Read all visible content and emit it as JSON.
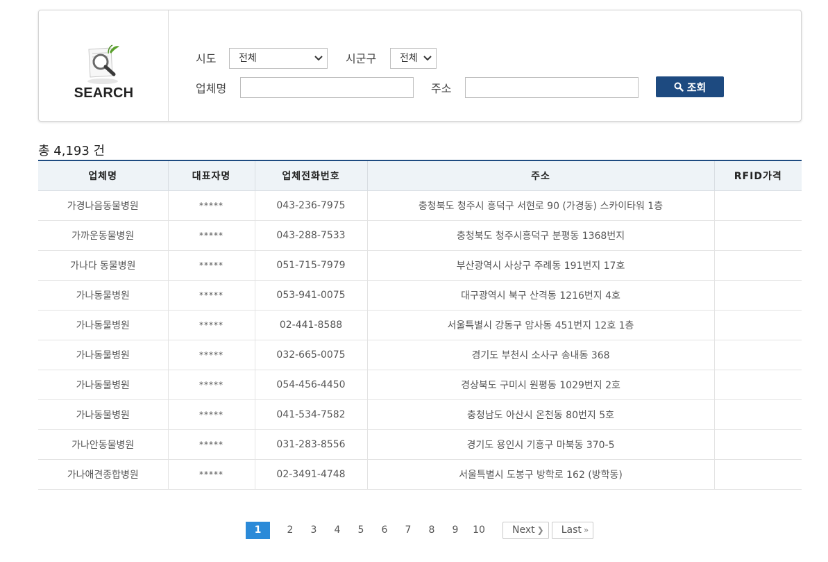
{
  "search": {
    "logo_text": "SEARCH",
    "sido_label": "시도",
    "sido_value": "전체",
    "sigungu_label": "시군구",
    "sigungu_value": "전체",
    "name_label": "업체명",
    "name_value": "",
    "address_label": "주소",
    "address_value": "",
    "button_label": "조회"
  },
  "total_text": "총 4,193 건",
  "table": {
    "columns": [
      "업체명",
      "대표자명",
      "업체전화번호",
      "주소",
      "RFID가격"
    ],
    "rows": [
      [
        "가경나음동물병원",
        "*****",
        "043-236-7975",
        "충청북도 청주시 흥덕구 서현로 90 (가경동) 스카이타워 1층",
        ""
      ],
      [
        "가까운동물병원",
        "*****",
        "043-288-7533",
        "충청북도 청주시흥덕구 분평동 1368번지",
        ""
      ],
      [
        "가나다 동물병원",
        "*****",
        "051-715-7979",
        "부산광역시 사상구 주례동 191번지 17호",
        ""
      ],
      [
        "가나동물병원",
        "*****",
        "053-941-0075",
        "대구광역시 북구 산격동 1216번지 4호",
        ""
      ],
      [
        "가나동물병원",
        "*****",
        "02-441-8588",
        "서울특별시 강동구 암사동 451번지 12호 1층",
        ""
      ],
      [
        "가나동물병원",
        "*****",
        "032-665-0075",
        "경기도 부천시 소사구 송내동 368",
        ""
      ],
      [
        "가나동물병원",
        "*****",
        "054-456-4450",
        "경상북도 구미시 원평동 1029번지 2호",
        ""
      ],
      [
        "가나동물병원",
        "*****",
        "041-534-7582",
        "충청남도 아산시 온천동 80번지 5호",
        ""
      ],
      [
        "가나안동물병원",
        "*****",
        "031-283-8556",
        "경기도 용인시 기흥구 마북동 370-5",
        ""
      ],
      [
        "가나애견종합병원",
        "*****",
        "02-3491-4748",
        "서울특별시 도봉구 방학로 162 (방학동)",
        ""
      ]
    ]
  },
  "pagination": {
    "pages": [
      "1",
      "2",
      "3",
      "4",
      "5",
      "6",
      "7",
      "8",
      "9",
      "10"
    ],
    "current": "1",
    "next_label": "Next",
    "last_label": "Last"
  },
  "colors": {
    "accent": "#1d4a80",
    "page_active": "#2b8ad8",
    "header_bg": "#eef3f7"
  }
}
